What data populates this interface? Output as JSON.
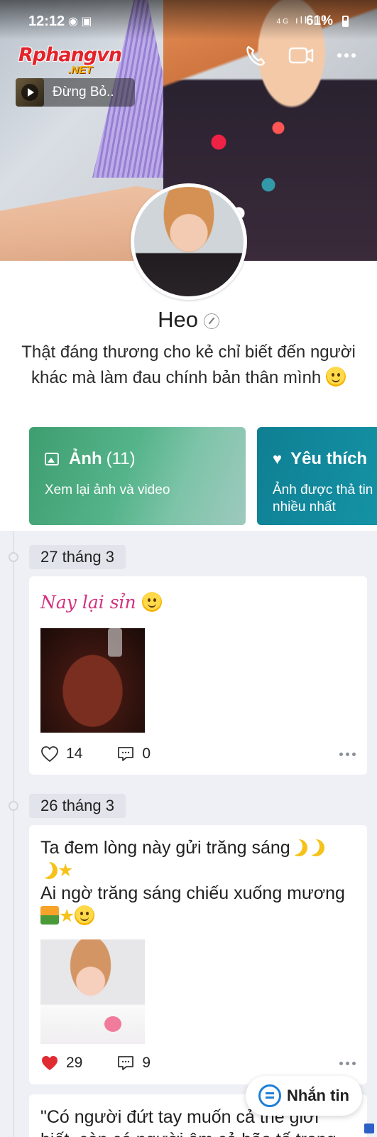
{
  "status_bar": {
    "time": "12:12",
    "network": "4G",
    "battery": "61%"
  },
  "watermark": {
    "main": "Rphangvn",
    "sub": ".NET"
  },
  "music": {
    "title": "Đừng Bỏ.."
  },
  "profile": {
    "name": "Heo",
    "bio": "Thật đáng thương cho kẻ chỉ biết đến người khác mà làm đau chính bản thân mình"
  },
  "cards": {
    "photos": {
      "title": "Ảnh",
      "count": "(11)",
      "subtitle": "Xem lại ảnh và video"
    },
    "favorites": {
      "title": "Yêu thích",
      "subtitle_line1": "Ảnh được thả tin",
      "subtitle_line2": "nhiều nhất"
    }
  },
  "posts": [
    {
      "date": "27 tháng 3",
      "text": "Nay lại sỉn",
      "likes": "14",
      "comments": "0",
      "liked": false
    },
    {
      "date": "26 tháng 3",
      "line1": "Ta đem lòng này gửi trăng sáng",
      "line2": "Ai ngờ trăng sáng chiếu xuống mương",
      "likes": "29",
      "comments": "9",
      "liked": true
    },
    {
      "line1": "\"Có người đứt tay muốn cả thế giới",
      "line2": "biết, còn có người ôm cả bão tố trong"
    }
  ],
  "message_button": {
    "label": "Nhắn tin"
  },
  "colors": {
    "like_red": "#e02b33",
    "accent_blue": "#1e7fd8",
    "script_pink": "#d3327f"
  }
}
